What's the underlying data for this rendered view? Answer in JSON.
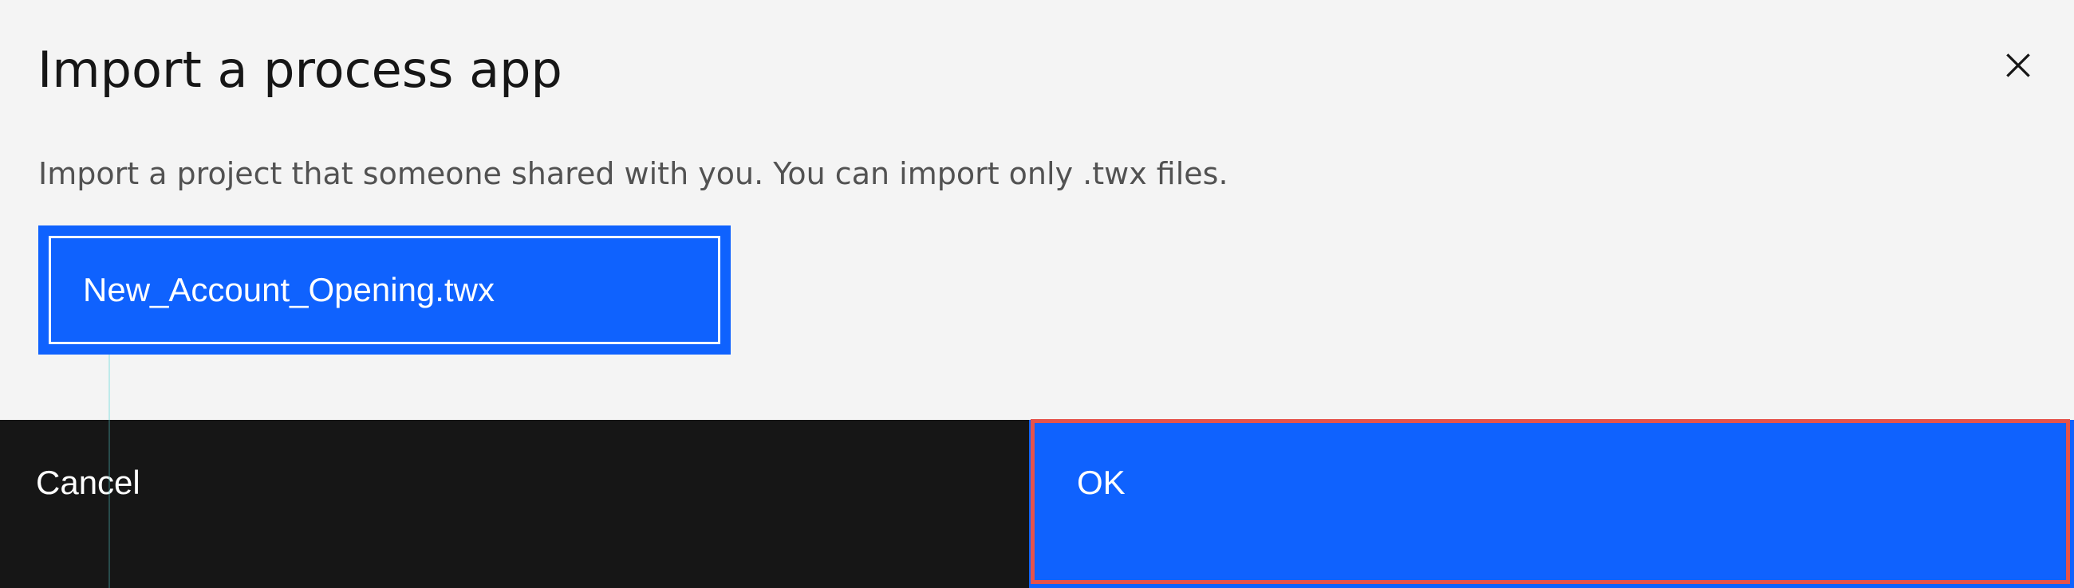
{
  "dialog": {
    "title": "Import a process app",
    "description": "Import a project that someone shared with you. You can import only .twx files.",
    "file_name": "New_Account_Opening.twx",
    "close_icon": "close-icon"
  },
  "footer": {
    "cancel_label": "Cancel",
    "ok_label": "OK"
  },
  "colors": {
    "background": "#f4f4f4",
    "primary": "#0f62fe",
    "secondary": "#161616",
    "highlight": "#e5534b"
  }
}
